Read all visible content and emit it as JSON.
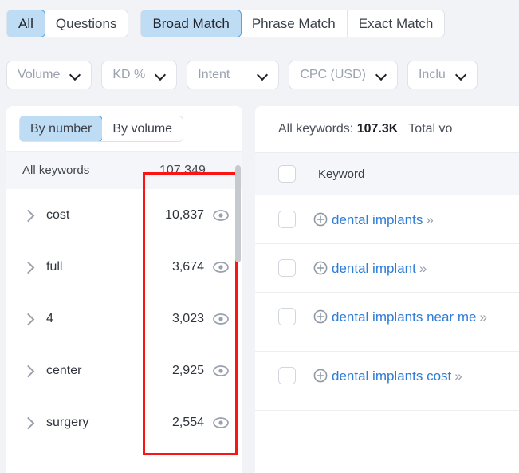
{
  "tabs_primary": [
    {
      "label": "All",
      "active": true
    },
    {
      "label": "Questions",
      "active": false
    }
  ],
  "tabs_match": [
    {
      "label": "Broad Match",
      "active": true
    },
    {
      "label": "Phrase Match",
      "active": false
    },
    {
      "label": "Exact Match",
      "active": false
    }
  ],
  "filters": [
    {
      "label": "Volume",
      "icon": "chevron-down-icon"
    },
    {
      "label": "KD %",
      "icon": "chevron-down-icon"
    },
    {
      "label": "Intent",
      "icon": "chevron-down-icon"
    },
    {
      "label": "CPC (USD)",
      "icon": "chevron-down-icon"
    },
    {
      "label": "Inclu",
      "icon": "chevron-down-icon"
    }
  ],
  "left_panel": {
    "view_tabs": [
      {
        "label": "By number",
        "active": true
      },
      {
        "label": "By volume",
        "active": false
      }
    ],
    "header": {
      "label": "All keywords",
      "value": "107,349"
    },
    "rows": [
      {
        "name": "cost",
        "value": "10,837",
        "eye": "eye-icon",
        "chevron": "chevron-right-icon"
      },
      {
        "name": "full",
        "value": "3,674",
        "eye": "eye-icon",
        "chevron": "chevron-right-icon"
      },
      {
        "name": "4",
        "value": "3,023",
        "eye": "eye-icon",
        "chevron": "chevron-right-icon"
      },
      {
        "name": "center",
        "value": "2,925",
        "eye": "eye-icon",
        "chevron": "chevron-right-icon"
      },
      {
        "name": "surgery",
        "value": "2,554",
        "eye": "eye-icon",
        "chevron": "chevron-right-icon"
      }
    ],
    "annotation": {
      "type": "red-rectangle-highlight",
      "color": "#fb1414"
    }
  },
  "right_panel": {
    "summary": {
      "all_keywords_label": "All keywords:",
      "all_keywords_value": "107.3K",
      "total_volume_label": "Total vo"
    },
    "column_header": "Keyword",
    "rows": [
      {
        "keyword": "dental implants",
        "add": "plus-circle-icon",
        "more": "»"
      },
      {
        "keyword": "dental implant",
        "add": "plus-circle-icon",
        "more": "»"
      },
      {
        "keyword": "dental implants near me",
        "add": "plus-circle-icon",
        "more": "»"
      },
      {
        "keyword": "dental implants cost",
        "add": "plus-circle-icon",
        "more": "»"
      }
    ]
  },
  "colors": {
    "accent_blue": "#2e7cd6",
    "tab_active_bg": "#bfdcf5",
    "tab_active_border": "#5aa2e0",
    "annotation_red": "#fb1414",
    "page_bg": "#f2f3f6"
  }
}
